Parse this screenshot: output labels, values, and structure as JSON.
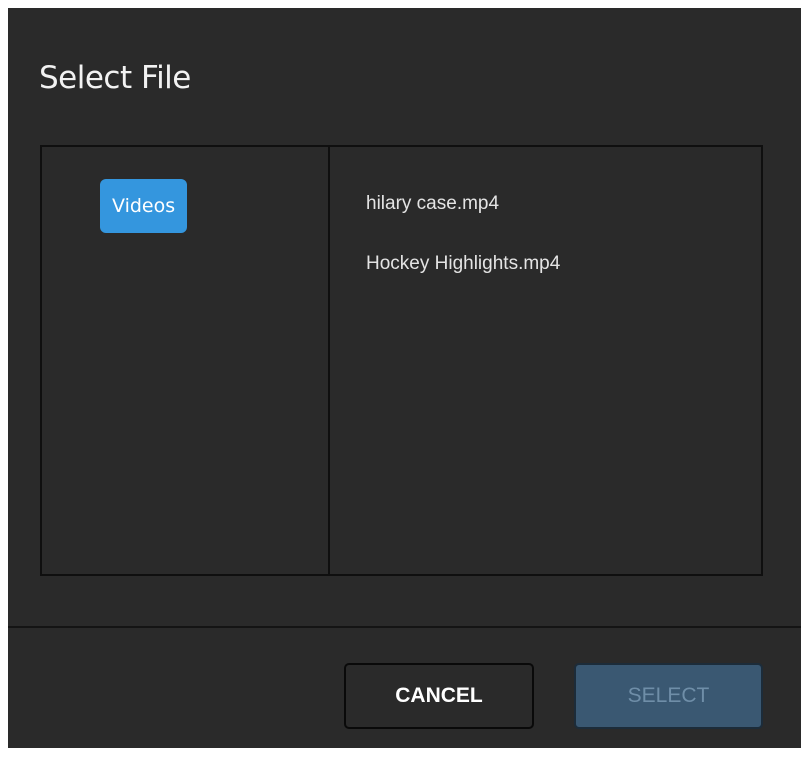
{
  "dialog": {
    "title": "Select File"
  },
  "folders": {
    "items": [
      {
        "label": "Videos",
        "selected": true
      }
    ]
  },
  "files": {
    "items": [
      {
        "label": "hilary case.mp4"
      },
      {
        "label": "Hockey Highlights.mp4"
      }
    ]
  },
  "footer": {
    "cancel_label": "CANCEL",
    "select_label": "SELECT",
    "select_enabled": false
  },
  "colors": {
    "dialog_bg": "#2a2a2a",
    "accent": "#3496de",
    "disabled_button_bg": "#3a5872"
  }
}
